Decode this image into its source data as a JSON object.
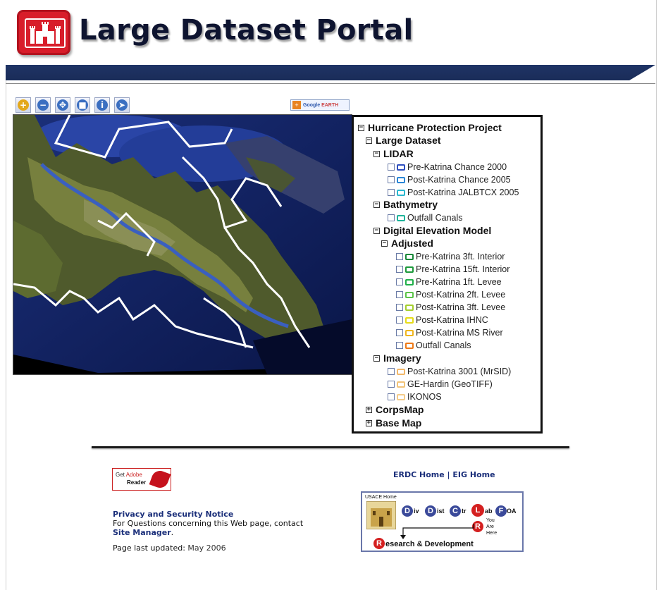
{
  "header": {
    "title": "Large Dataset Portal",
    "logo": "castle-icon",
    "brand_color": "#d81d2a",
    "band_color": "#1f3466"
  },
  "toolbar": {
    "tools": [
      {
        "name": "zoom-in-icon",
        "glyph": "+",
        "color": "#e3a81c"
      },
      {
        "name": "zoom-out-icon",
        "glyph": "−",
        "color": "#3b6fc1"
      },
      {
        "name": "pan-icon",
        "glyph": "✥",
        "color": "#3b6fc1"
      },
      {
        "name": "full-extent-icon",
        "glyph": "■",
        "color": "#3b6fc1"
      },
      {
        "name": "info-icon",
        "glyph": "i",
        "color": "#3b6fc1"
      },
      {
        "name": "select-pointer-icon",
        "glyph": "➤",
        "color": "#3b6fc1"
      }
    ],
    "google_earth": {
      "google": "Google",
      "earth": "EARTH"
    }
  },
  "tree": {
    "root": "Hurricane Protection Project",
    "large_dataset": "Large Dataset",
    "lidar": "LIDAR",
    "lidar_items": [
      {
        "label": "Pre-Katrina Chance 2000",
        "color": "#2f4fbf"
      },
      {
        "label": "Post-Katrina Chance 2005",
        "color": "#2a86d6"
      },
      {
        "label": "Post-Katrina JALBTCX 2005",
        "color": "#2ab8d0"
      }
    ],
    "bathymetry": "Bathymetry",
    "bathymetry_items": [
      {
        "label": "Outfall Canals",
        "color": "#1fb39a"
      }
    ],
    "dem": "Digital Elevation Model",
    "adjusted": "Adjusted",
    "adjusted_items": [
      {
        "label": "Pre-Katrina 3ft. Interior",
        "color": "#1a8a3a"
      },
      {
        "label": "Pre-Katrina 15ft. Interior",
        "color": "#1e9a3c"
      },
      {
        "label": "Pre-Katrina 1ft. Levee",
        "color": "#20b04a"
      },
      {
        "label": "Post-Katrina 2ft. Levee",
        "color": "#5cc44a"
      },
      {
        "label": "Post-Katrina 3ft. Levee",
        "color": "#a6cf2e"
      },
      {
        "label": "Post-Katrina IHNC",
        "color": "#e6dc1a"
      },
      {
        "label": "Post-Katrina MS River",
        "color": "#f0b61e"
      },
      {
        "label": "Outfall Canals",
        "color": "#ee7a18"
      }
    ],
    "imagery": "Imagery",
    "imagery_items": [
      {
        "label": "Post-Katrina 3001 (MrSID)",
        "color": "#f2b86a"
      },
      {
        "label": "GE-Hardin (GeoTIFF)",
        "color": "#f2c47a"
      },
      {
        "label": "IKONOS",
        "color": "#f5cc8a"
      }
    ],
    "corpsmap": "CorpsMap",
    "basemap": "Base Map"
  },
  "footer": {
    "adobe_get": "Get",
    "adobe_brand": "Adobe",
    "adobe_reader": "Reader",
    "privacy": "Privacy and Security Notice",
    "questions": "For Questions concerning this Web page, contact",
    "site_manager": "Site Manager",
    "site_manager_period": ".",
    "updated_prefix": "Page last updated:",
    "updated_month": "May 2006",
    "erdc_home": "ERDC Home",
    "sep": "|",
    "eig_home": "EIG Home"
  },
  "org": {
    "usace_home": "USACE Home",
    "div": "iv",
    "dist": "ist",
    "ctr": "tr",
    "lab": "ab",
    "foa": "OA",
    "you": "You",
    "are": "Are",
    "here": "Here",
    "research": "esearch",
    "amp": "&",
    "development": "Development",
    "letters": {
      "D": "D",
      "C": "C",
      "L": "L",
      "F": "F",
      "R": "R"
    }
  }
}
